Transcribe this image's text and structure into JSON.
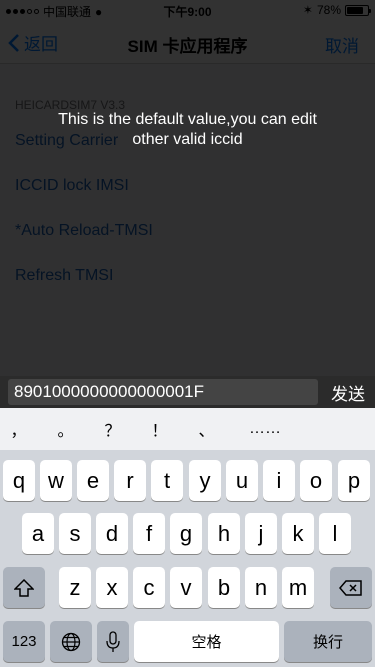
{
  "status": {
    "carrier": "中国联通",
    "time": "下午9:00",
    "battery": "78%",
    "battery_level": 0.78
  },
  "nav": {
    "back": "返回",
    "title": "SIM 卡应用程序",
    "cancel": "取消"
  },
  "list": {
    "header": "HEICARDSIM7 V3.3",
    "items": [
      "Setting Carrier",
      "ICCID lock IMSI",
      "*Auto Reload-TMSI",
      "Refresh TMSI"
    ]
  },
  "toast": {
    "line1": "This is the default value,you can edit",
    "line2": "other valid iccid"
  },
  "input": {
    "value": "8901000000000000001F",
    "send": "发送"
  },
  "keyboard": {
    "candidates": [
      "，",
      "。",
      "？",
      "！",
      "、",
      "……"
    ],
    "row1": [
      "q",
      "w",
      "e",
      "r",
      "t",
      "y",
      "u",
      "i",
      "o",
      "p"
    ],
    "row2": [
      "a",
      "s",
      "d",
      "f",
      "g",
      "h",
      "j",
      "k",
      "l"
    ],
    "row3": [
      "z",
      "x",
      "c",
      "v",
      "b",
      "n",
      "m"
    ],
    "numbers": "123",
    "space": "空格",
    "return": "换行"
  }
}
